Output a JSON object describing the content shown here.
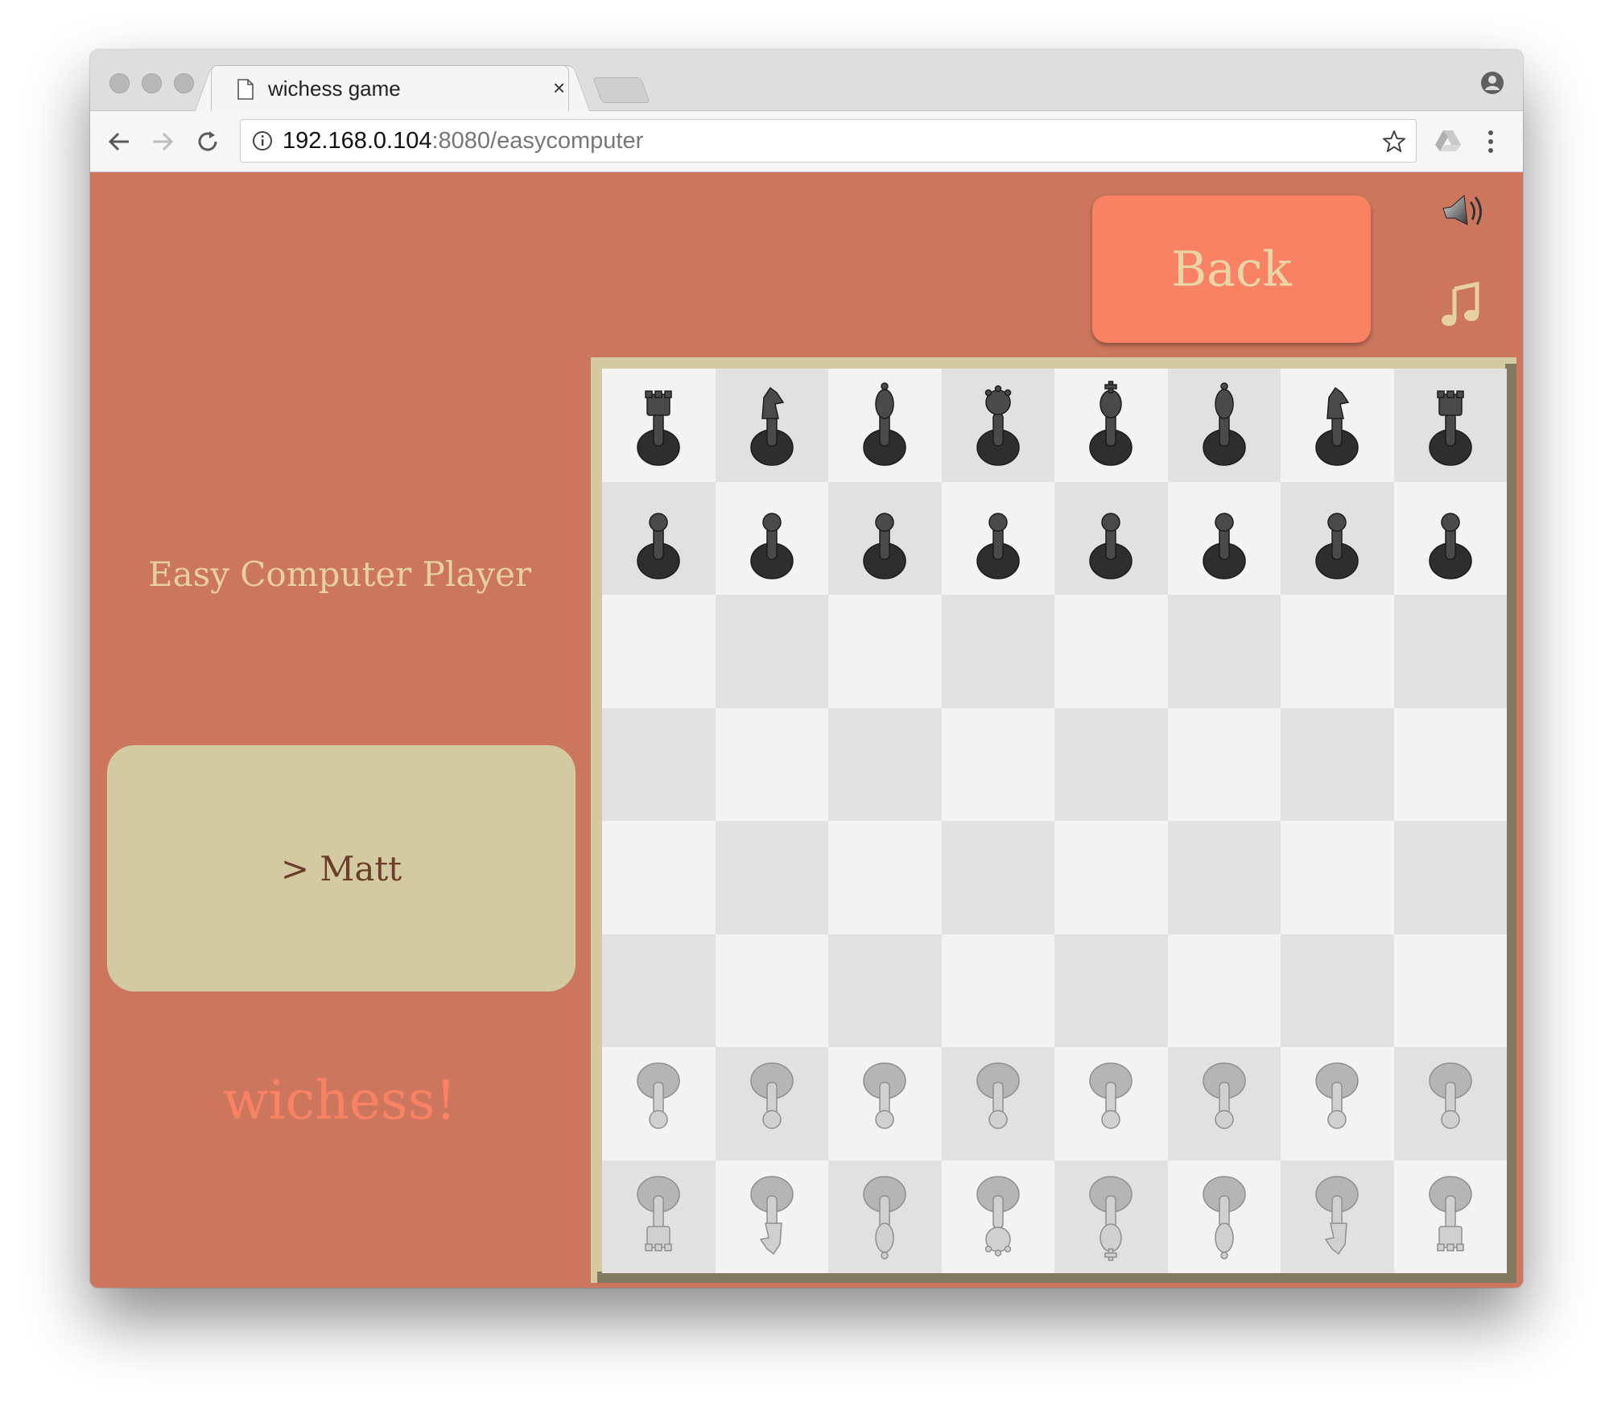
{
  "browser": {
    "tab_title": "wichess game",
    "tab_close": "×",
    "url_host": "192.168.0.104",
    "url_path": ":8080/easycomputer"
  },
  "page": {
    "back_label": "Back",
    "player_label": "Easy Computer Player",
    "turn_label": "> Matt",
    "logo_text": "wichess!",
    "colors": {
      "background": "#cc775d",
      "button": "#f98265",
      "panel": "#d4caa2",
      "light_square": "#f3f3f3",
      "dark_square": "#e1e1e1"
    }
  },
  "board": {
    "rows": [
      [
        "black-rook",
        "black-knight",
        "black-bishop",
        "black-queen",
        "black-king",
        "black-bishop",
        "black-knight",
        "black-rook"
      ],
      [
        "black-pawn",
        "black-pawn",
        "black-pawn",
        "black-pawn",
        "black-pawn",
        "black-pawn",
        "black-pawn",
        "black-pawn"
      ],
      [
        "",
        "",
        "",
        "",
        "",
        "",
        "",
        ""
      ],
      [
        "",
        "",
        "",
        "",
        "",
        "",
        "",
        ""
      ],
      [
        "",
        "",
        "",
        "",
        "",
        "",
        "",
        ""
      ],
      [
        "",
        "",
        "",
        "",
        "",
        "",
        "",
        ""
      ],
      [
        "white-pawn",
        "white-pawn",
        "white-pawn",
        "white-pawn",
        "white-pawn",
        "white-pawn",
        "white-pawn",
        "white-pawn"
      ],
      [
        "white-rook",
        "white-knight",
        "white-bishop",
        "white-queen",
        "white-king",
        "white-bishop",
        "white-knight",
        "white-rook"
      ]
    ]
  }
}
